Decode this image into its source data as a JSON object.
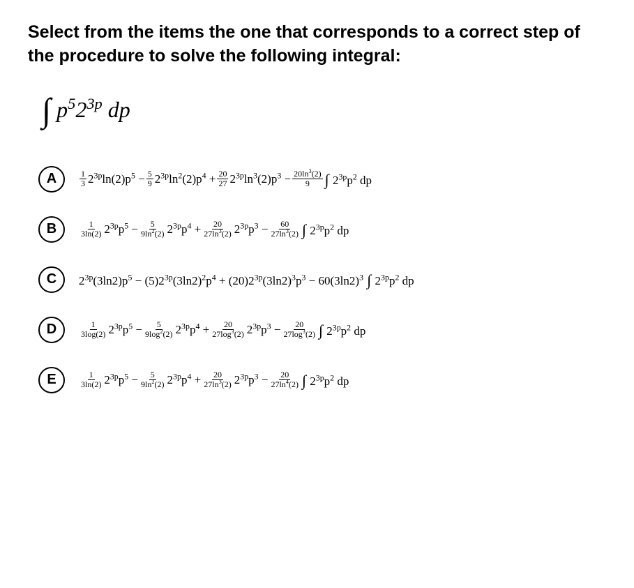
{
  "prompt": "Select from the items the one that corresponds to a correct step of the procedure to solve the following integral:",
  "integral_html": "<span class=\"int-sign\">∫</span> p<sup>5</sup>2<sup>3p</sup> dp",
  "options": [
    {
      "label": "A",
      "expr_html": "<span class=\"frac\"><span class=\"num\">1</span><span class=\"den\">3</span></span><span class=\"mid\">2<sup>3p</sup>ln(2)p<sup>5</sup> − </span><span class=\"frac\"><span class=\"num\">5</span><span class=\"den\">9</span></span><span class=\"mid\">2<sup>3p</sup>ln<sup>2</sup>(2)p<sup>4</sup> + </span><span class=\"frac\"><span class=\"num\">20</span><span class=\"den\">27</span></span><span class=\"mid\">2<sup>3p</sup>ln<sup>3</sup>(2)p<sup>3</sup> − </span><span class=\"frac\"><span class=\"num\">20ln<sup>3</sup>(2)</span><span class=\"den\">9</span></span><span class=\"mid\"> <span class=\"int-s\">∫</span> 2<sup>3p</sup>p<sup>2</sup> dp</span>"
    },
    {
      "label": "B",
      "expr_html": "<span class=\"frac\"><span class=\"num\">1</span><span class=\"den\">3ln(2)</span></span><span class=\"mid\">2<sup>3p</sup>p<sup>5</sup> − </span><span class=\"frac\"><span class=\"num\">5</span><span class=\"den\">9ln<sup>2</sup>(2)</span></span><span class=\"mid\">2<sup>3p</sup>p<sup>4</sup> + </span><span class=\"frac\"><span class=\"num\">20</span><span class=\"den\">27ln<sup>3</sup>(2)</span></span><span class=\"mid\">2<sup>3p</sup>p<sup>3</sup> − </span><span class=\"frac\"><span class=\"num\">60</span><span class=\"den\">27ln<sup>3</sup>(2)</span></span><span class=\"mid\"> <span class=\"int-s\">∫</span> 2<sup>3p</sup>p<sup>2</sup> dp</span>"
    },
    {
      "label": "C",
      "expr_html": "<span class=\"mid\">2<sup>3p</sup>(3ln2)p<sup>5</sup> − (5)2<sup>3p</sup>(3ln2)<sup>2</sup>p<sup>4</sup> + (20)2<sup>3p</sup>(3ln2)<sup>3</sup>p<sup>3</sup> − 60(3ln2)<sup>3</sup> <span class=\"int-s\">∫</span> 2<sup>3p</sup>p<sup>2</sup> dp</span>"
    },
    {
      "label": "D",
      "expr_html": "<span class=\"frac\"><span class=\"num\">1</span><span class=\"den\">3log(2)</span></span><span class=\"mid\">2<sup>3p</sup>p<sup>5</sup> − </span><span class=\"frac\"><span class=\"num\">5</span><span class=\"den\">9log<sup>2</sup>(2)</span></span><span class=\"mid\">2<sup>3p</sup>p<sup>4</sup> + </span><span class=\"frac\"><span class=\"num\">20</span><span class=\"den\">27log<sup>3</sup>(2)</span></span><span class=\"mid\">2<sup>3p</sup>p<sup>3</sup> − </span><span class=\"frac\"><span class=\"num\">20</span><span class=\"den\">27log<sup>3</sup>(2)</span></span><span class=\"mid\"> <span class=\"int-s\">∫</span> 2<sup>3p</sup>p<sup>2</sup> dp</span>"
    },
    {
      "label": "E",
      "expr_html": "<span class=\"frac\"><span class=\"num\">1</span><span class=\"den\">3ln(2)</span></span><span class=\"mid\">2<sup>3p</sup>p<sup>5</sup> − </span><span class=\"frac\"><span class=\"num\">5</span><span class=\"den\">9ln<sup>2</sup>(2)</span></span><span class=\"mid\">2<sup>3p</sup>p<sup>4</sup> + </span><span class=\"frac\"><span class=\"num\">20</span><span class=\"den\">27ln<sup>3</sup>(2)</span></span><span class=\"mid\">2<sup>3p</sup>p<sup>3</sup> − </span><span class=\"frac\"><span class=\"num\">20</span><span class=\"den\">27ln<sup>4</sup>(2)</span></span><span class=\"mid\"> <span class=\"int-s\">∫</span> 2<sup>3p</sup>p<sup>2</sup> dp</span>"
    }
  ]
}
